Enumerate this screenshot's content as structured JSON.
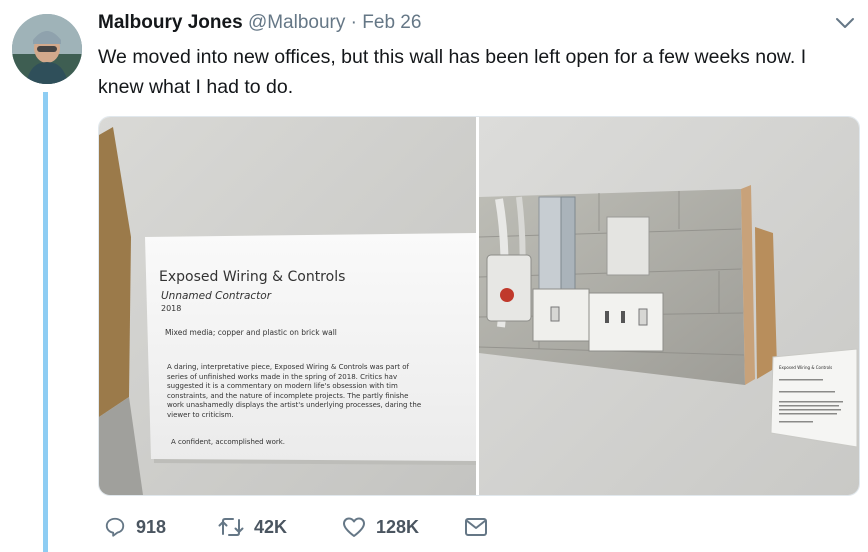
{
  "tweet": {
    "author_name": "Malboury Jones",
    "handle": "@Malboury",
    "separator": "·",
    "date": "Feb 26",
    "text": "We moved into new offices, but this wall has been left open for a few weeks now. I knew what I had to do."
  },
  "placard": {
    "title": "Exposed Wiring & Controls",
    "artist": "Unnamed Contractor",
    "year": "2018",
    "medium": "Mixed media; copper and plastic on brick wall",
    "description_lines": [
      "A daring, interpretative piece, Exposed Wiring & Controls was part of",
      "series of unfinished works made in the spring of 2018. Critics hav",
      "suggested it is a commentary on modern life's obsession with tim",
      "constraints, and the nature of incomplete projects. The partly finishe",
      "work unashamedly displays the artist's underlying processes, daring the",
      "viewer to criticism."
    ],
    "verdict": "A confident, accomplished work."
  },
  "actions": {
    "replies": "918",
    "retweets": "42K",
    "likes": "128K"
  },
  "colors": {
    "thread_line": "#8ecdf3",
    "secondary_text": "#657786",
    "icon": "#657786"
  },
  "icons": {
    "caret": "chevron-down-icon",
    "reply": "reply-icon",
    "retweet": "retweet-icon",
    "like": "heart-icon",
    "dm": "envelope-icon"
  }
}
